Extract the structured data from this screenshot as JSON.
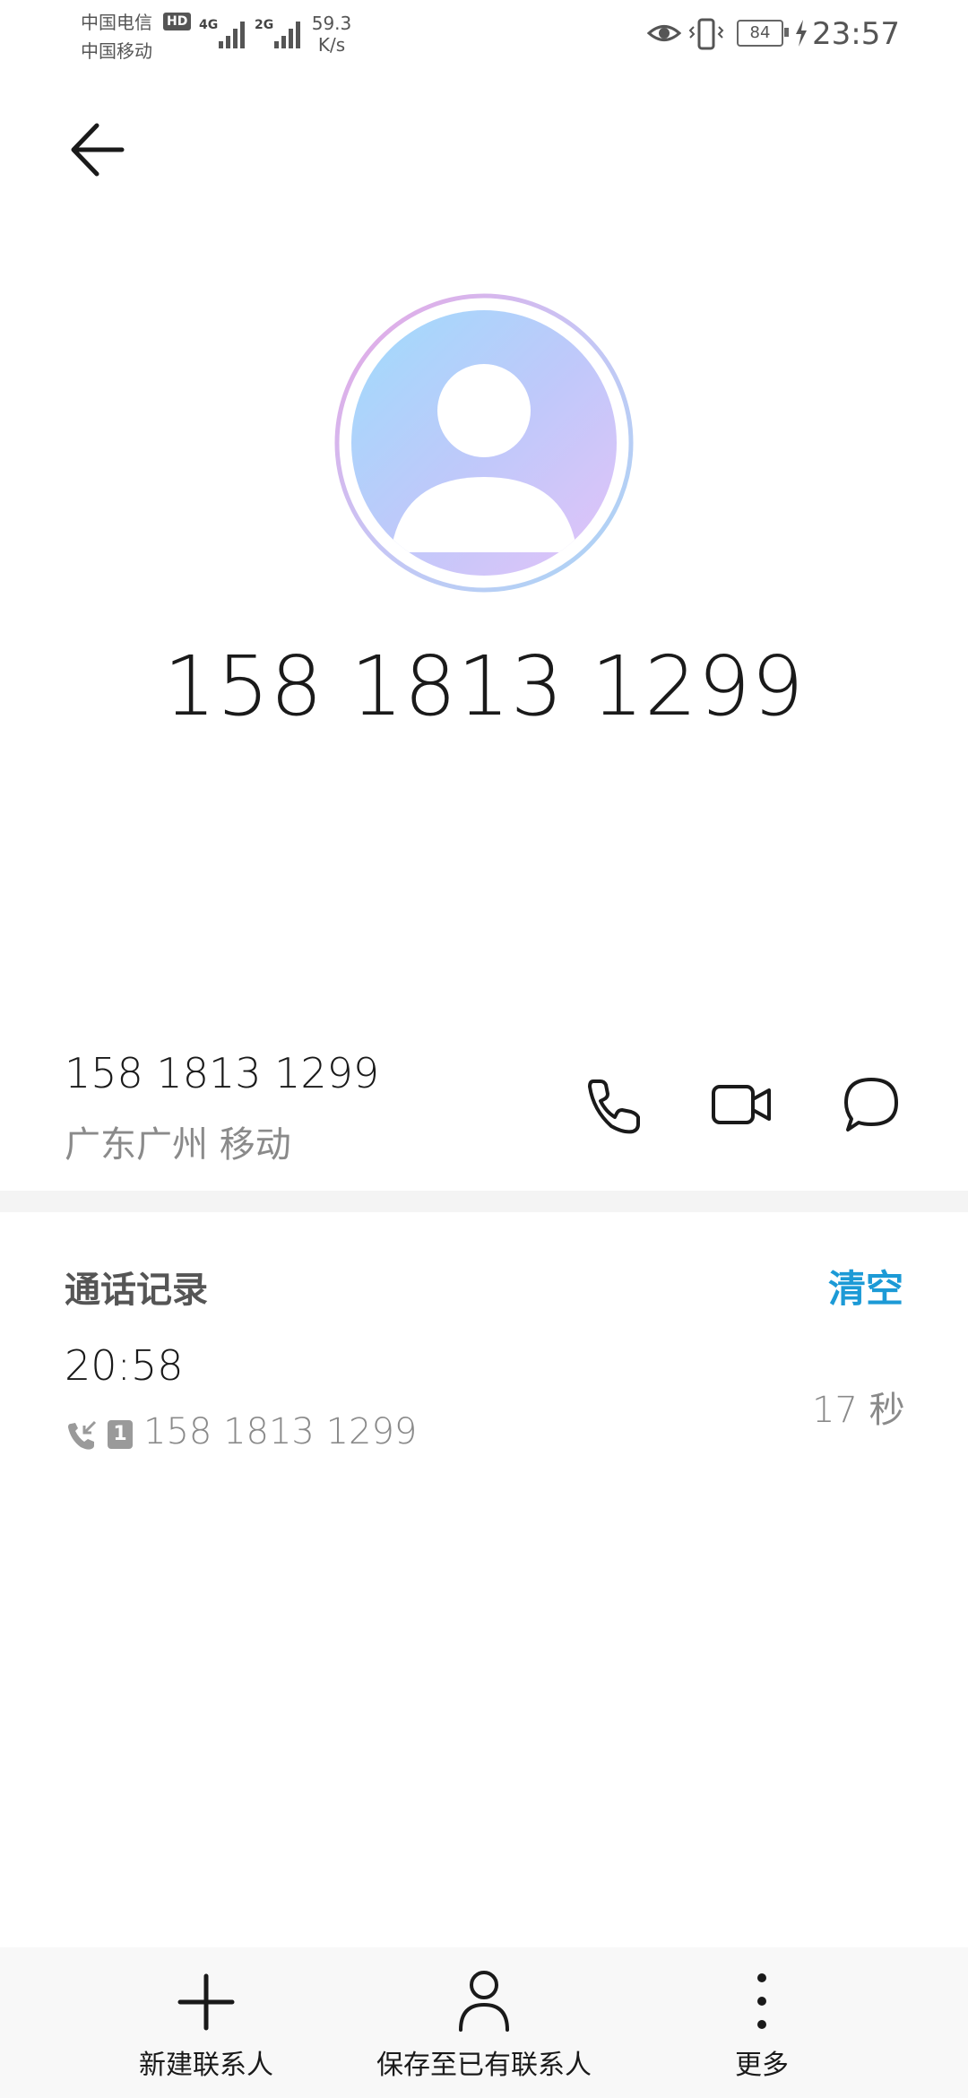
{
  "status_bar": {
    "carrier1": "中国电信",
    "carrier2": "中国移动",
    "hd": "HD",
    "net1": "4G",
    "net2": "2G",
    "speed_value": "59.3",
    "speed_unit": "K/s",
    "battery": "84",
    "time": "23:57"
  },
  "profile": {
    "title_number": "158 1813 1299"
  },
  "contact": {
    "number": "158 1813 1299",
    "location": "广东广州 移动"
  },
  "call_log": {
    "title": "通话记录",
    "clear_label": "清空",
    "entries": [
      {
        "time": "20:58",
        "sim": "1",
        "number": "158 1813 1299",
        "duration": "17 秒"
      }
    ]
  },
  "bottom_bar": {
    "new_contact": "新建联系人",
    "save_existing": "保存至已有联系人",
    "more": "更多"
  },
  "colors": {
    "accent": "#1c9ad6"
  }
}
